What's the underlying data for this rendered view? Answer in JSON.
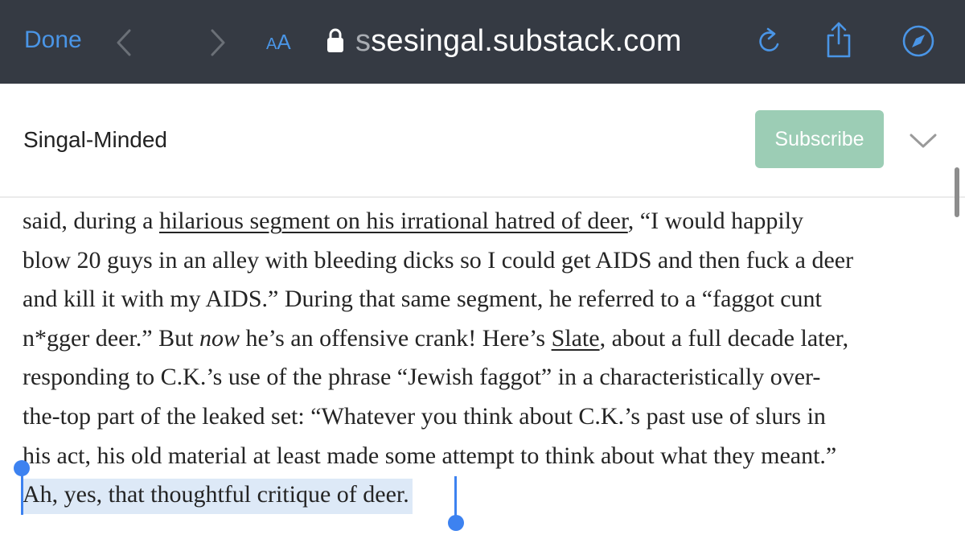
{
  "toolbar": {
    "done_label": "Done",
    "back_icon": "chevron-left-icon",
    "forward_icon": "chevron-right-icon",
    "text_size_small": "A",
    "text_size_large": "A",
    "lock_icon": "lock-icon",
    "url_faded": "s",
    "url_main": "sesingal.substack.com",
    "reload_icon": "reload-icon",
    "share_icon": "share-icon",
    "compass_icon": "compass-icon",
    "background_color": "#353a43",
    "accent_color": "#4a95e6"
  },
  "header": {
    "site_title": "Singal-Minded",
    "subscribe_label": "Subscribe",
    "subscribe_color": "#9ccdb5",
    "menu_icon": "chevron-down-icon"
  },
  "article": {
    "l1_a": "said, during a ",
    "l1_link": "hilarious segment on his irrational hatred of deer",
    "l1_b": ", “I would happily",
    "l2": "blow 20 guys in an alley with bleeding dicks so I could get AIDS and then fuck a deer",
    "l3": "and kill it with my AIDS.” During that same segment, he referred to a “faggot cunt",
    "l4_a": "n*gger deer.” But ",
    "l4_em": "now",
    "l4_b": " he’s an offensive crank! Here’s ",
    "l4_link": "Slate",
    "l4_c": ", about a full decade later,",
    "l5": "responding to C.K.’s use of the phrase “Jewish faggot” in a characteristically over-",
    "l6": "the-top part of the leaked set: “Whatever you think about C.K.’s past use of slurs in",
    "l7": "his act, his old material at least made some attempt to think about what they meant.”",
    "l8_selected": "Ah, yes, that thoughtful critique of deer.",
    "selection_color": "#dde9f7",
    "handle_color": "#3d82f0"
  }
}
